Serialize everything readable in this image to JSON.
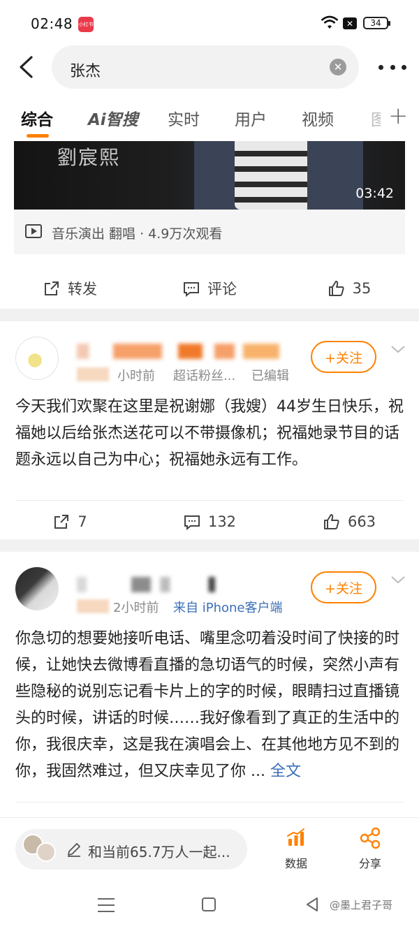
{
  "status_bar": {
    "time": "02:48",
    "app_badge": "小红书",
    "battery": "34"
  },
  "search": {
    "query": "张杰",
    "clear_icon": "clear-icon",
    "more_icon": "more-icon"
  },
  "tabs": [
    {
      "label": "综合",
      "active": true
    },
    {
      "label": "Ai智搜",
      "active": false
    },
    {
      "label": "实时",
      "active": false
    },
    {
      "label": "用户",
      "active": false
    },
    {
      "label": "视频",
      "active": false
    }
  ],
  "tab_plus": "+",
  "video_card": {
    "watermark": "劉宸熙",
    "duration": "03:42",
    "meta": "音乐演出 翻唱 · 4.9万次观看",
    "actions": {
      "repost": "转发",
      "comment": "评论",
      "like": "35"
    }
  },
  "post1": {
    "time": "小时前",
    "source": "超话粉丝...",
    "edited": "已编辑",
    "follow": "+关注",
    "text": "今天我们欢聚在这里是祝谢娜（我嫂）44岁生日快乐，祝福她以后给张杰送花可以不带摄像机；祝福她录节目的话题永远以自己为中心；祝福她永远有工作。",
    "actions": {
      "repost": "7",
      "comment": "132",
      "like": "663"
    }
  },
  "post2": {
    "time": "2小时前",
    "source": "来自 iPhone客户端",
    "follow": "+关注",
    "text": "你急切的想要她接听电话、嘴里念叨着没时间了快接的时候，让她快去微博看直播的急切语气的时候，突然小声有些隐秘的说别忘记看卡片上的字的时候，眼睛扫过直播镜头的时候，讲话的时候……我好像看到了真正的生活中的你，我很庆幸，这是我在演唱会上、在其他地方见不到的你，我固然难过，但又庆幸见了你 ...",
    "more": "全文"
  },
  "bottom_bar": {
    "live_text": "和当前65.7万人一起...",
    "data_label": "数据",
    "share_label": "分享"
  },
  "watermark": "@墨上君子哥",
  "colors": {
    "accent": "#ff8200",
    "link": "#3b6fb6",
    "separator": "#f1f1f1"
  }
}
